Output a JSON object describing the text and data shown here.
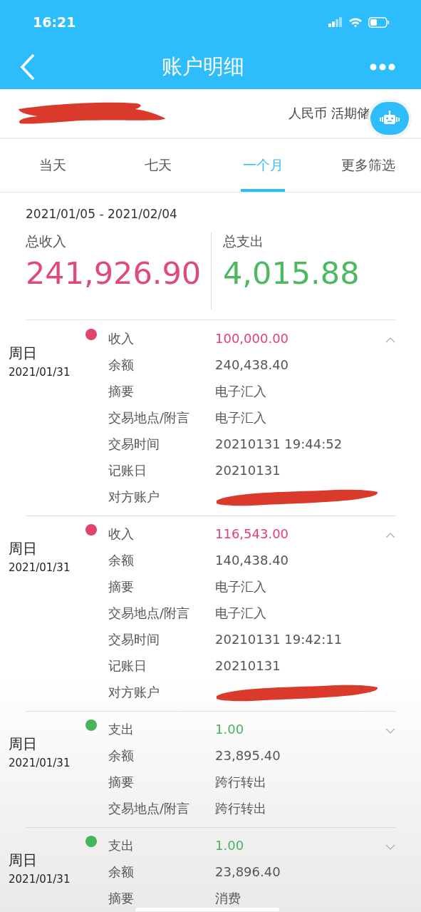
{
  "status_bar": {
    "time": "16:21"
  },
  "nav": {
    "title": "账户明细"
  },
  "account": {
    "redacted": true,
    "type": "人民币 活期储"
  },
  "tabs": [
    {
      "label": "当天",
      "selected": false
    },
    {
      "label": "七天",
      "selected": false
    },
    {
      "label": "一个月",
      "selected": true
    },
    {
      "label": "更多筛选",
      "selected": false
    }
  ],
  "summary": {
    "range": "2021/01/05 - 2021/02/04",
    "income_label": "总收入",
    "income": "241,926.90",
    "expense_label": "总支出",
    "expense": "4,015.88"
  },
  "entries": [
    {
      "weekday": "周日",
      "date": "2021/01/31",
      "color": "#e3416f",
      "expanded": true,
      "type": "收入",
      "amount": "100,000.00",
      "fields": [
        {
          "kind": "text",
          "label": "余额",
          "value": "240,438.40"
        },
        {
          "kind": "text",
          "label": "摘要",
          "value": "电子汇入"
        },
        {
          "kind": "text",
          "label": "交易地点/附言",
          "value": "电子汇入"
        },
        {
          "kind": "text",
          "label": "交易时间",
          "value": "20210131 19:44:52"
        },
        {
          "kind": "text",
          "label": "记账日",
          "value": "20210131"
        },
        {
          "kind": "redacted",
          "label": "对方账户"
        }
      ]
    },
    {
      "weekday": "周日",
      "date": "2021/01/31",
      "color": "#e3416f",
      "expanded": true,
      "type": "收入",
      "amount": "116,543.00",
      "fields": [
        {
          "kind": "text",
          "label": "余额",
          "value": "140,438.40"
        },
        {
          "kind": "text",
          "label": "摘要",
          "value": "电子汇入"
        },
        {
          "kind": "text",
          "label": "交易地点/附言",
          "value": "电子汇入"
        },
        {
          "kind": "text",
          "label": "交易时间",
          "value": "20210131 19:42:11"
        },
        {
          "kind": "text",
          "label": "记账日",
          "value": "20210131"
        },
        {
          "kind": "redacted",
          "label": "对方账户"
        }
      ]
    },
    {
      "weekday": "周日",
      "date": "2021/01/31",
      "color": "#45b560",
      "expanded": false,
      "type": "支出",
      "amount": "1.00",
      "fields": [
        {
          "kind": "text",
          "label": "余额",
          "value": "23,895.40"
        },
        {
          "kind": "text",
          "label": "摘要",
          "value": "跨行转出"
        },
        {
          "kind": "text",
          "label": "交易地点/附言",
          "value": "跨行转出"
        }
      ]
    },
    {
      "weekday": "周日",
      "date": "2021/01/31",
      "color": "#45b560",
      "expanded": false,
      "type": "支出",
      "amount": "1.00",
      "fields": [
        {
          "kind": "text",
          "label": "余额",
          "value": "23,896.40"
        },
        {
          "kind": "text",
          "label": "摘要",
          "value": "消费"
        }
      ]
    }
  ]
}
